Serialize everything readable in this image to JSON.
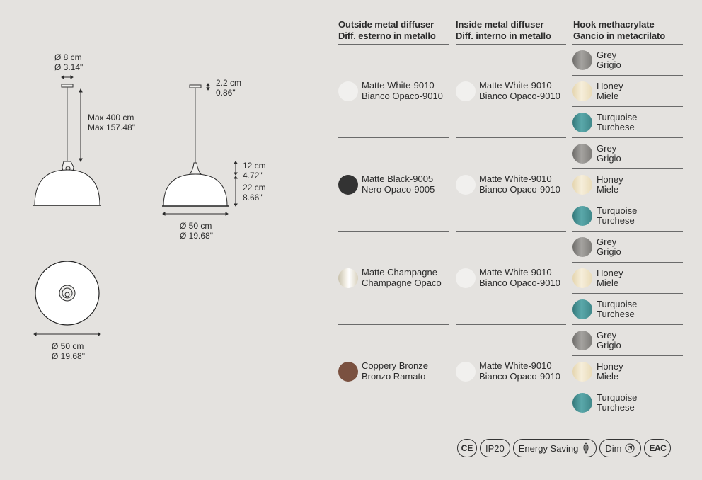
{
  "dimensions": {
    "hook_width_cm": "Ø 8 cm",
    "hook_width_in": "Ø 3.14\"",
    "max_length_cm": "Max 400 cm",
    "max_length_in": "Max 157.48\"",
    "canopy_height_cm": "2.2 cm",
    "canopy_height_in": "0.86\"",
    "neck_height_cm": "12 cm",
    "neck_height_in": "4.72\"",
    "dome_height_cm": "22 cm",
    "dome_height_in": "8.66\"",
    "side_diameter_cm": "Ø 50 cm",
    "side_diameter_in": "Ø 19.68\"",
    "top_diameter_cm": "Ø 50 cm",
    "top_diameter_in": "Ø 19.68\""
  },
  "headers": [
    {
      "en": "Outside metal diffuser",
      "it": "Diff. esterno in metallo"
    },
    {
      "en": "Inside metal diffuser",
      "it": "Diff. interno in metallo"
    },
    {
      "en": "Hook methacrylate",
      "it": "Gancio in metacrilato"
    }
  ],
  "colors": {
    "white": "#f1f0ee",
    "black": "#333333",
    "champagne": "#e6e1d3",
    "bronze": "#7a5140",
    "grey": "#8b8986",
    "honey": "#efe3c6",
    "turquoise": "#4a9597"
  },
  "rows": [
    {
      "outside": {
        "en": "Matte White-9010",
        "it": "Bianco Opaco-9010",
        "color": "#f1f0ee"
      },
      "inside": {
        "en": "Matte White-9010",
        "it": "Bianco Opaco-9010",
        "color": "#f1f0ee"
      },
      "hooks": [
        {
          "en": "Grey",
          "it": "Grigio",
          "color": "#8b8986"
        },
        {
          "en": "Honey",
          "it": "Miele",
          "color": "#efe3c6"
        },
        {
          "en": "Turquoise",
          "it": "Turchese",
          "color": "#4a9597"
        }
      ]
    },
    {
      "outside": {
        "en": "Matte Black-9005",
        "it": "Nero Opaco-9005",
        "color": "#333333"
      },
      "inside": {
        "en": "Matte White-9010",
        "it": "Bianco Opaco-9010",
        "color": "#f1f0ee"
      },
      "hooks": [
        {
          "en": "Grey",
          "it": "Grigio",
          "color": "#8b8986"
        },
        {
          "en": "Honey",
          "it": "Miele",
          "color": "#efe3c6"
        },
        {
          "en": "Turquoise",
          "it": "Turchese",
          "color": "#4a9597"
        }
      ]
    },
    {
      "outside": {
        "en": "Matte Champagne",
        "it": "Champagne Opaco",
        "color": "#e6e1d3"
      },
      "inside": {
        "en": "Matte White-9010",
        "it": "Bianco Opaco-9010",
        "color": "#f1f0ee"
      },
      "hooks": [
        {
          "en": "Grey",
          "it": "Grigio",
          "color": "#8b8986"
        },
        {
          "en": "Honey",
          "it": "Miele",
          "color": "#efe3c6"
        },
        {
          "en": "Turquoise",
          "it": "Turchese",
          "color": "#4a9597"
        }
      ]
    },
    {
      "outside": {
        "en": "Coppery Bronze",
        "it": "Bronzo Ramato",
        "color": "#7a5140"
      },
      "inside": {
        "en": "Matte White-9010",
        "it": "Bianco Opaco-9010",
        "color": "#f1f0ee"
      },
      "hooks": [
        {
          "en": "Grey",
          "it": "Grigio",
          "color": "#8b8986"
        },
        {
          "en": "Honey",
          "it": "Miele",
          "color": "#efe3c6"
        },
        {
          "en": "Turquoise",
          "it": "Turchese",
          "color": "#4a9597"
        }
      ]
    }
  ],
  "certifications": {
    "ce": "CE",
    "ip": "IP20",
    "energy": "Energy Saving",
    "dim": "Dim",
    "eac": "EAC"
  }
}
